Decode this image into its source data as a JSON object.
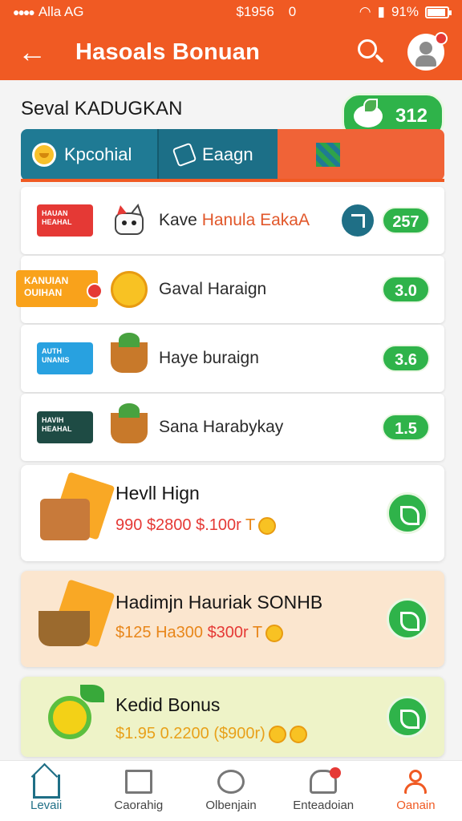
{
  "status": {
    "carrier": "Alla AG",
    "time": "$1956",
    "alarm": "0",
    "battery_text": "91%",
    "battery_level": 0.91
  },
  "header": {
    "title": "Hasoals Bonuan",
    "back_icon": "back-arrow-icon",
    "search_icon": "search-icon",
    "avatar_icon": "avatar-icon",
    "accent_color": "#f05a23"
  },
  "section": {
    "title": "Seval KADUGKAN",
    "badge_value": "312"
  },
  "tabs": [
    {
      "label": "Kpcohial",
      "icon": "smile-coin-icon"
    },
    {
      "label": "Eaagn",
      "icon": "edit-icon"
    },
    {
      "label": "",
      "icon": "grid-pattern-icon"
    }
  ],
  "rows": [
    {
      "thumb_text": "HAUAN HEAHAL",
      "icon": "cat-mascot-icon",
      "label": "Kave ",
      "label_accent": "Hanula EakaA",
      "value": "257",
      "has_send": true
    },
    {
      "thumb_text": "KANUIAN OUIHAN",
      "icon": "gold-coin-icon",
      "label": "Gaval Haraign",
      "label_accent": "",
      "value": "3.0",
      "has_send": false
    },
    {
      "thumb_text": "AUTH UNANIS",
      "icon": "basket-icon",
      "label": "Haye buraign",
      "label_accent": "",
      "value": "3.6",
      "has_send": false
    },
    {
      "thumb_text": "HAVIH HEAHAL",
      "icon": "fruit-basket-icon",
      "label": "Sana Harabykay",
      "label_accent": "",
      "value": "1.5",
      "has_send": false
    }
  ],
  "bonuses": [
    {
      "name": "Hevll Hign",
      "price1": "990",
      "price2": "$2800",
      "price3": "$.100r",
      "price4": "T",
      "art": "crate-ticket-icon",
      "bg": "#ffffff"
    },
    {
      "name": "Hadimjn Hauriak SONHB",
      "price1": "$125",
      "price2": "Ha300",
      "price3": "$300r",
      "price4": "T",
      "art": "basket-ticket-icon",
      "bg": "#fbe6cf"
    },
    {
      "name": "Kedid Bonus",
      "price1": "$1.95",
      "price2": "0.2200",
      "price3": "($900r)",
      "price4": "",
      "art": "sun-leaf-icon",
      "bg": "#eef3c8"
    }
  ],
  "nav": [
    {
      "label": "Levaii",
      "icon": "home-icon",
      "state": "active-blue"
    },
    {
      "label": "Caorahig",
      "icon": "store-icon",
      "state": ""
    },
    {
      "label": "Olbenjain",
      "icon": "globe-icon",
      "state": ""
    },
    {
      "label": "Enteadoian",
      "icon": "bell-icon",
      "state": ""
    },
    {
      "label": "Oanain",
      "icon": "person-icon",
      "state": "active-orange"
    }
  ]
}
